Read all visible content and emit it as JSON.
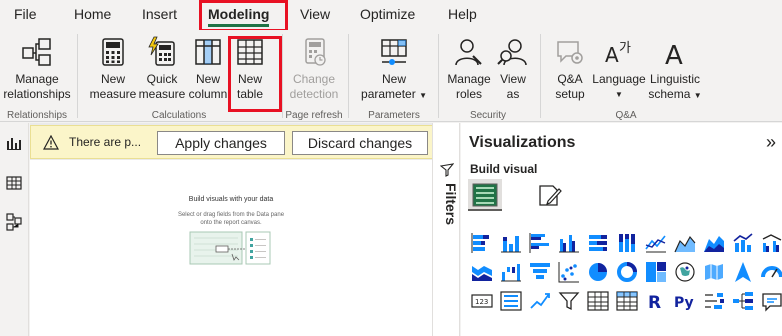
{
  "menu": {
    "items": [
      {
        "label": "File"
      },
      {
        "label": "Home"
      },
      {
        "label": "Insert"
      },
      {
        "label": "Modeling"
      },
      {
        "label": "View"
      },
      {
        "label": "Optimize"
      },
      {
        "label": "Help"
      }
    ],
    "active": "Modeling"
  },
  "ribbon": {
    "manage_relationships": {
      "line1": "Manage",
      "line2": "relationships"
    },
    "new_measure": {
      "line1": "New",
      "line2": "measure"
    },
    "quick_measure": {
      "line1": "Quick",
      "line2": "measure"
    },
    "new_column": {
      "line1": "New",
      "line2": "column"
    },
    "new_table": {
      "line1": "New",
      "line2": "table"
    },
    "change_detection": {
      "line1": "Change",
      "line2": "detection"
    },
    "new_parameter": {
      "line1": "New",
      "line2": "parameter"
    },
    "manage_roles": {
      "line1": "Manage",
      "line2": "roles"
    },
    "view_as": {
      "line1": "View",
      "line2": "as"
    },
    "qa_setup": {
      "line1": "Q&A",
      "line2": "setup"
    },
    "language": {
      "line1": "Language"
    },
    "linguistic_schema": {
      "line1": "Linguistic",
      "line2": "schema"
    },
    "groups": {
      "relationships": "Relationships",
      "calculations": "Calculations",
      "page_refresh": "Page refresh",
      "parameters": "Parameters",
      "security": "Security",
      "qa": "Q&A"
    }
  },
  "warning": {
    "text": "There are p...",
    "apply_label": "Apply changes",
    "discard_label": "Discard changes"
  },
  "canvas": {
    "empty_title": "Build visuals with your data",
    "empty_sub1": "Select or drag fields from the Data pane",
    "empty_sub2": "onto the report canvas."
  },
  "filters": {
    "label": "Filters"
  },
  "visualizations": {
    "title": "Visualizations",
    "build_visual": "Build visual",
    "icons": [
      "stacked-bar-chart-icon",
      "stacked-column-chart-icon",
      "clustered-bar-chart-icon",
      "clustered-column-chart-icon",
      "100-stacked-bar-chart-icon",
      "100-stacked-column-chart-icon",
      "line-chart-icon",
      "area-chart-icon",
      "stacked-area-chart-icon",
      "line-and-stacked-column-chart-icon",
      "line-and-clustered-column-chart-icon",
      "ribbon-chart-icon",
      "waterfall-chart-icon",
      "funnel-chart-icon",
      "scatter-chart-icon",
      "pie-chart-icon",
      "donut-chart-icon",
      "treemap-icon",
      "map-icon",
      "filled-map-icon",
      "azure-map-icon",
      "gauge-icon",
      "card-icon",
      "multi-row-card-icon",
      "kpi-icon",
      "slicer-icon",
      "table-icon",
      "matrix-icon",
      "r-script-visual-icon",
      "python-visual-icon",
      "key-influencers-icon",
      "decomposition-tree-icon",
      "qa-visual-icon"
    ],
    "colors": {
      "accent_blue": "#118dff",
      "dark_blue": "#12239e",
      "teal": "#41a4a0"
    }
  }
}
